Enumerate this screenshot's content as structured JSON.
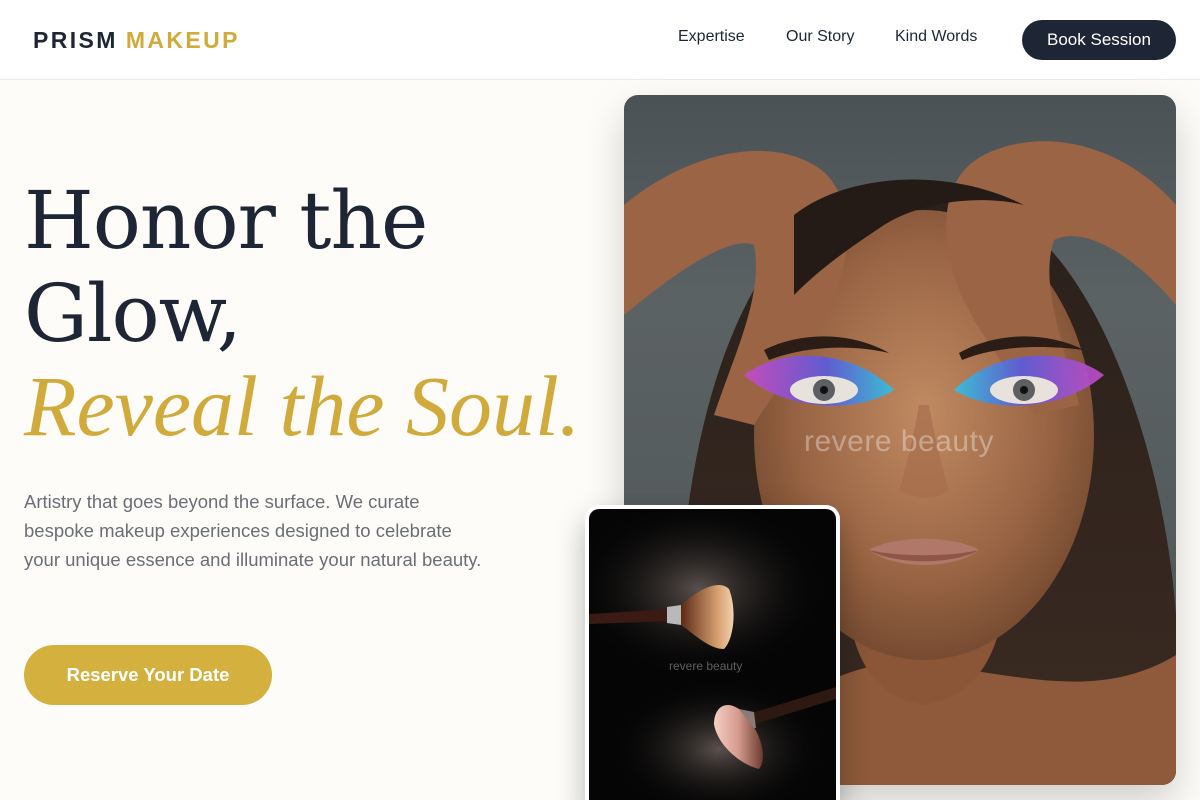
{
  "brand": {
    "name_part1": "PRISM",
    "name_part2": "MAKEUP"
  },
  "nav": {
    "items": [
      {
        "label": "Expertise"
      },
      {
        "label": "Our Story"
      },
      {
        "label": "Kind Words"
      }
    ],
    "cta_label": "Book Session"
  },
  "hero": {
    "headline_line1": "Honor the",
    "headline_line2": "Glow,",
    "headline_accent": "Reveal the Soul.",
    "description": "Artistry that goes beyond the surface. We curate bespoke makeup experiences designed to celebrate your unique essence and illuminate your natural beauty.",
    "cta_label": "Reserve Your Date"
  },
  "images": {
    "portrait_watermark": "revere beauty",
    "brush_watermark": "revere beauty"
  },
  "colors": {
    "navy": "#1e2535",
    "gold": "#d0ab3c",
    "background": "#fdfcf8",
    "muted_text": "#6b6e76"
  }
}
